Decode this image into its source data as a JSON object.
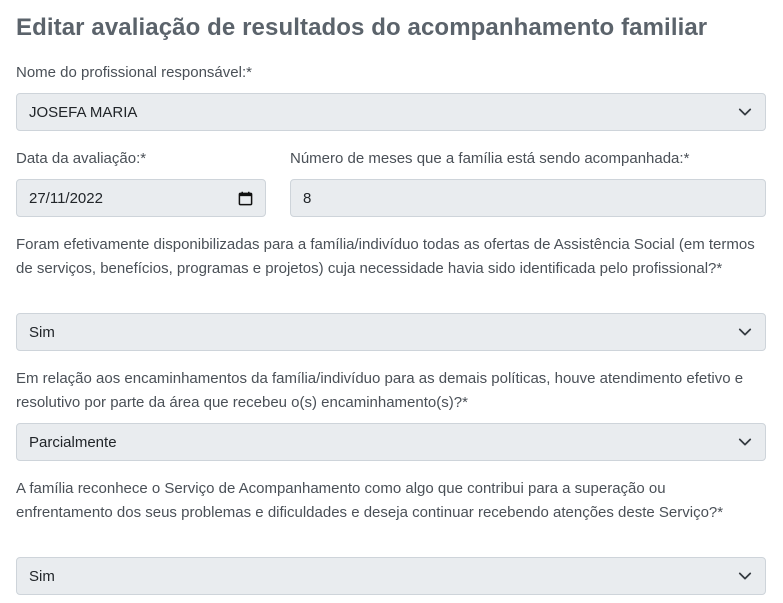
{
  "page": {
    "title": "Editar avaliação de resultados do acompanhamento familiar"
  },
  "form": {
    "professional": {
      "label": "Nome do profissional responsável:*",
      "value": "JOSEFA MARIA"
    },
    "evaluation_date": {
      "label": "Data da avaliação:*",
      "value": "27/11/2022"
    },
    "months": {
      "label": "Número de meses que a família está sendo acompanhada:*",
      "value": "8"
    },
    "q_offers": {
      "label": "Foram efetivamente disponibilizadas para a família/indivíduo todas as ofertas de Assistência Social (em termos de serviços, benefícios, programas e projetos) cuja necessidade havia sido identificada pelo profissional?*",
      "value": "Sim"
    },
    "q_referrals": {
      "label": "Em relação aos encaminhamentos da família/indivíduo para as demais políticas, houve atendimento efetivo e resolutivo por parte da área que recebeu o(s) encaminhamento(s)?*",
      "value": "Parcialmente"
    },
    "q_recognition": {
      "label": "A família reconhece o Serviço de Acompanhamento como algo que contribui para a superação ou enfrentamento dos seus problemas e dificuldades e deseja continuar recebendo atenções deste Serviço?*",
      "value": "Sim"
    }
  },
  "icons": {
    "select": "chevron-down-icon",
    "date": "calendar-icon"
  },
  "colors": {
    "field_bg": "#e9ecef",
    "border": "#ced4da",
    "title": "#5b636b"
  }
}
